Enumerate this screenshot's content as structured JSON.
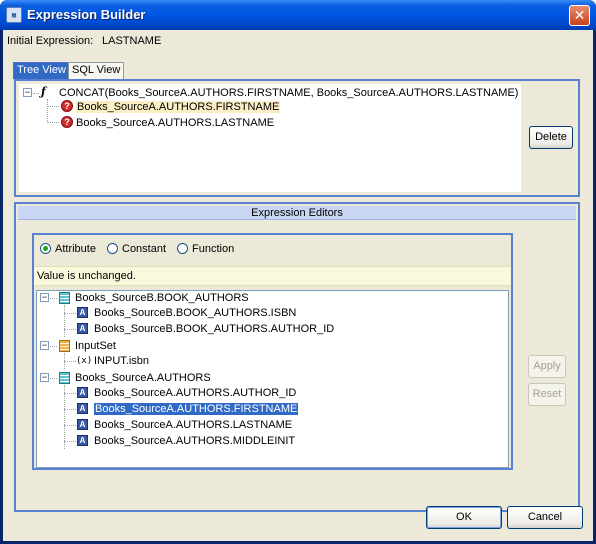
{
  "window": {
    "title": "Expression Builder",
    "close_glyph": "✕",
    "icon": "expression-builder-icon"
  },
  "initial_expression": {
    "label": "Initial Expression:",
    "value": "LASTNAME"
  },
  "tabs": [
    {
      "label": "Tree View",
      "selected": true
    },
    {
      "label": "SQL View",
      "selected": false
    }
  ],
  "expression_tree": {
    "root": {
      "label": "CONCAT(Books_SourceA.AUTHORS.FIRSTNAME, Books_SourceA.AUTHORS.LASTNAME)",
      "icon": "function-icon",
      "expanded": true
    },
    "children": [
      {
        "label": "Books_SourceA.AUTHORS.FIRSTNAME",
        "icon": "unresolved-icon",
        "highlighted": true
      },
      {
        "label": "Books_SourceA.AUTHORS.LASTNAME",
        "icon": "unresolved-icon",
        "highlighted": false
      }
    ]
  },
  "buttons": {
    "delete": "Delete",
    "apply": "Apply",
    "reset": "Reset",
    "ok": "OK",
    "cancel": "Cancel"
  },
  "editors": {
    "header": "Expression Editors",
    "radios": [
      {
        "label": "Attribute",
        "selected": true
      },
      {
        "label": "Constant",
        "selected": false
      },
      {
        "label": "Function",
        "selected": false
      }
    ],
    "status": "Value is unchanged."
  },
  "attribute_tree": [
    {
      "label": "Books_SourceB.BOOK_AUTHORS",
      "icon": "table-icon",
      "expanded": true,
      "children": [
        {
          "label": "Books_SourceB.BOOK_AUTHORS.ISBN",
          "icon": "attribute-icon"
        },
        {
          "label": "Books_SourceB.BOOK_AUTHORS.AUTHOR_ID",
          "icon": "attribute-icon"
        }
      ]
    },
    {
      "label": "InputSet",
      "icon": "inputset-icon",
      "expanded": true,
      "children": [
        {
          "label": "INPUT.isbn",
          "icon": "variable-icon"
        }
      ]
    },
    {
      "label": "Books_SourceA.AUTHORS",
      "icon": "table-icon",
      "expanded": true,
      "children": [
        {
          "label": "Books_SourceA.AUTHORS.AUTHOR_ID",
          "icon": "attribute-icon"
        },
        {
          "label": "Books_SourceA.AUTHORS.FIRSTNAME",
          "icon": "attribute-icon",
          "selected": true
        },
        {
          "label": "Books_SourceA.AUTHORS.LASTNAME",
          "icon": "attribute-icon"
        },
        {
          "label": "Books_SourceA.AUTHORS.MIDDLEINIT",
          "icon": "attribute-icon"
        }
      ]
    }
  ],
  "icon_glyphs": {
    "function": "ƒ",
    "unresolved": "?",
    "attribute": "A",
    "variable": "(x)",
    "collapse": "−"
  },
  "colors": {
    "selection": "#316ac5",
    "titlebar": "#0055e5",
    "panel_border": "#5a81d1"
  }
}
